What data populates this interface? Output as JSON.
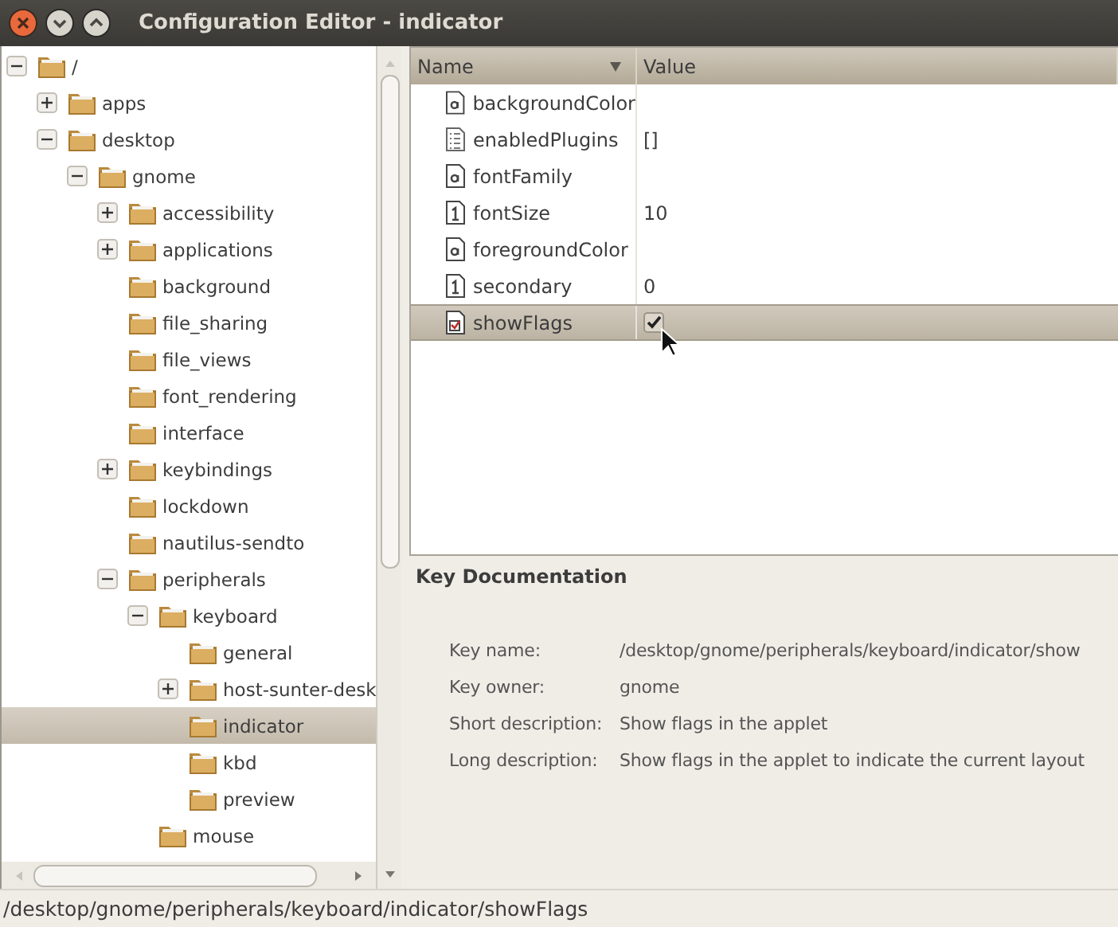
{
  "window": {
    "title": "Configuration Editor - indicator"
  },
  "tree": [
    {
      "label": "/",
      "expanded": true,
      "selected": false,
      "children": [
        {
          "label": "apps",
          "expanded": false,
          "selected": false
        },
        {
          "label": "desktop",
          "expanded": true,
          "selected": false,
          "children": [
            {
              "label": "gnome",
              "expanded": true,
              "selected": false,
              "children": [
                {
                  "label": "accessibility",
                  "expanded": false,
                  "selected": false
                },
                {
                  "label": "applications",
                  "expanded": false,
                  "selected": false
                },
                {
                  "label": "background",
                  "selected": false
                },
                {
                  "label": "file_sharing",
                  "selected": false
                },
                {
                  "label": "file_views",
                  "selected": false
                },
                {
                  "label": "font_rendering",
                  "selected": false
                },
                {
                  "label": "interface",
                  "selected": false
                },
                {
                  "label": "keybindings",
                  "expanded": false,
                  "selected": false
                },
                {
                  "label": "lockdown",
                  "selected": false
                },
                {
                  "label": "nautilus-sendto",
                  "selected": false
                },
                {
                  "label": "peripherals",
                  "expanded": true,
                  "selected": false,
                  "children": [
                    {
                      "label": "keyboard",
                      "expanded": true,
                      "selected": false,
                      "children": [
                        {
                          "label": "general",
                          "selected": false
                        },
                        {
                          "label": "host-sunter-desk",
                          "expanded": false,
                          "selected": false
                        },
                        {
                          "label": "indicator",
                          "selected": true
                        },
                        {
                          "label": "kbd",
                          "selected": false
                        },
                        {
                          "label": "preview",
                          "selected": false
                        }
                      ]
                    },
                    {
                      "label": "mouse",
                      "selected": false
                    }
                  ]
                }
              ]
            }
          ]
        }
      ]
    }
  ],
  "table": {
    "columns": [
      "Name",
      "Value"
    ],
    "rows": [
      {
        "name": "backgroundColor",
        "kind": "string",
        "selected": false
      },
      {
        "name": "enabledPlugins",
        "kind": "list",
        "value": "[]",
        "selected": false
      },
      {
        "name": "fontFamily",
        "kind": "string",
        "selected": false
      },
      {
        "name": "fontSize",
        "kind": "int",
        "value": "10",
        "selected": false
      },
      {
        "name": "foregroundColor",
        "kind": "string",
        "selected": false
      },
      {
        "name": "secondary",
        "kind": "int",
        "value": "0",
        "selected": false
      },
      {
        "name": "showFlags",
        "kind": "bool",
        "checked": true,
        "selected": true
      }
    ]
  },
  "doc": {
    "heading": "Key Documentation",
    "fields": [
      {
        "label": "Key name:",
        "value": "/desktop/gnome/peripherals/keyboard/indicator/show"
      },
      {
        "label": "Key owner:",
        "value": "gnome"
      },
      {
        "label": "Short description:",
        "value": "Show flags in the applet"
      },
      {
        "label": "Long description:",
        "value": "Show flags in the applet to indicate the current layout"
      }
    ]
  },
  "status_bar": "/desktop/gnome/peripherals/keyboard/indicator/showFlags"
}
